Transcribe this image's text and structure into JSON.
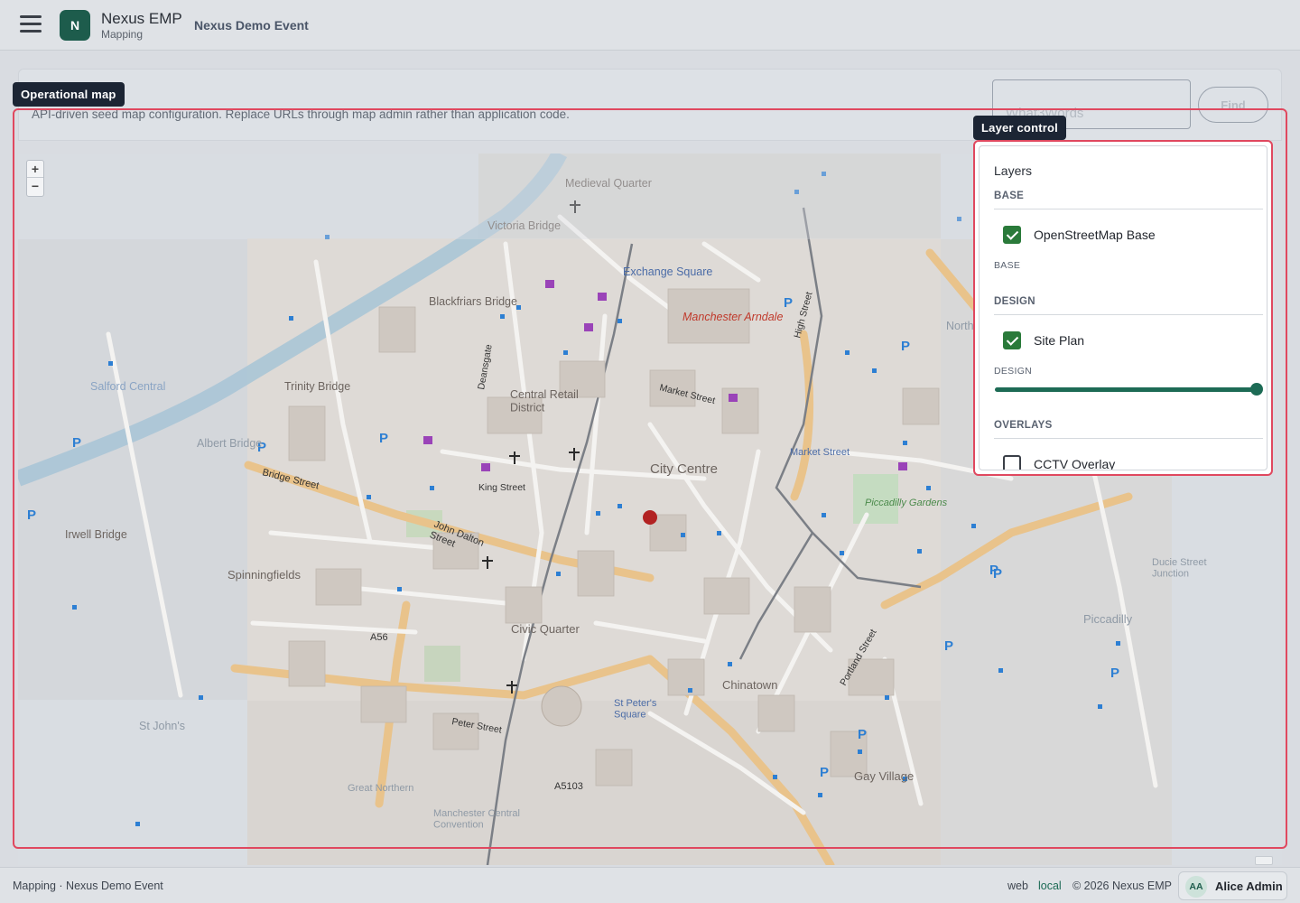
{
  "header": {
    "logo_letter": "N",
    "app_name": "Nexus EMP",
    "section": "Mapping",
    "event_name": "Nexus Demo Event",
    "menu_icon": "hamburger-icon"
  },
  "page": {
    "tooltip_map": "Operational map",
    "description": "API-driven seed map configuration. Replace URLs through map admin rather than application code.",
    "what3words_placeholder": "What3Words",
    "find_label": "Find"
  },
  "map": {
    "zoom_in": "+",
    "zoom_out": "−",
    "labels": {
      "medieval_quarter": "Medieval Quarter",
      "victoria_bridge": "Victoria Bridge",
      "exchange_square": "Exchange Square",
      "manchester_arndale": "Manchester Arndale",
      "blackfriars_bridge": "Blackfriars Bridge",
      "central_retail": "Central Retail District",
      "city_centre": "City Centre",
      "trinity_bridge": "Trinity Bridge",
      "salford_central": "Salford Central",
      "albert_bridge": "Albert Bridge",
      "spinningfields": "Spinningfields",
      "irwell_bridge": "Irwell Bridge",
      "civic_quarter": "Civic Quarter",
      "chinatown": "Chinatown",
      "st_peters_square": "St Peter's Square",
      "piccadilly_gardens": "Piccadilly Gardens",
      "piccadilly": "Piccadilly",
      "gay_village": "Gay Village",
      "market_street": "Market Street",
      "great_northern": "Great Northern",
      "manchester_central": "Manchester Central Convention",
      "northern": "Northern",
      "st_johns": "St John's",
      "ducie_street": "Ducie Street Junction",
      "a56": "A56",
      "a5103": "A5103",
      "bridge_street": "Bridge Street",
      "john_dalton_street": "John Dalton Street",
      "king_street": "King Street",
      "market_st_road": "Market Street",
      "peter_street": "Peter Street",
      "deansgate": "Deansgate",
      "portland_street": "Portland Street",
      "high_street": "High Street"
    }
  },
  "layer_control": {
    "tooltip": "Layer control",
    "title": "Layers",
    "base_section": "BASE",
    "base_layer_label": "OpenStreetMap Base",
    "base_layer_checked": true,
    "base_caption": "BASE",
    "design_section": "DESIGN",
    "design_layer_label": "Site Plan",
    "design_layer_checked": true,
    "design_caption": "DESIGN",
    "design_opacity": 1.0,
    "overlays_section": "OVERLAYS",
    "overlay_layer_label": "CCTV Overlay",
    "overlay_layer_checked": false
  },
  "footer": {
    "left": "Mapping · Nexus Demo Event",
    "env_web": "web",
    "env_local": "local",
    "copyright": "© 2026 Nexus EMP",
    "user_initials": "AA",
    "user_name": "Alice Admin"
  },
  "colors": {
    "brand": "#1d5c4c",
    "highlight": "#e0485f",
    "check": "#2a7a3a",
    "marker": "#b22222"
  }
}
